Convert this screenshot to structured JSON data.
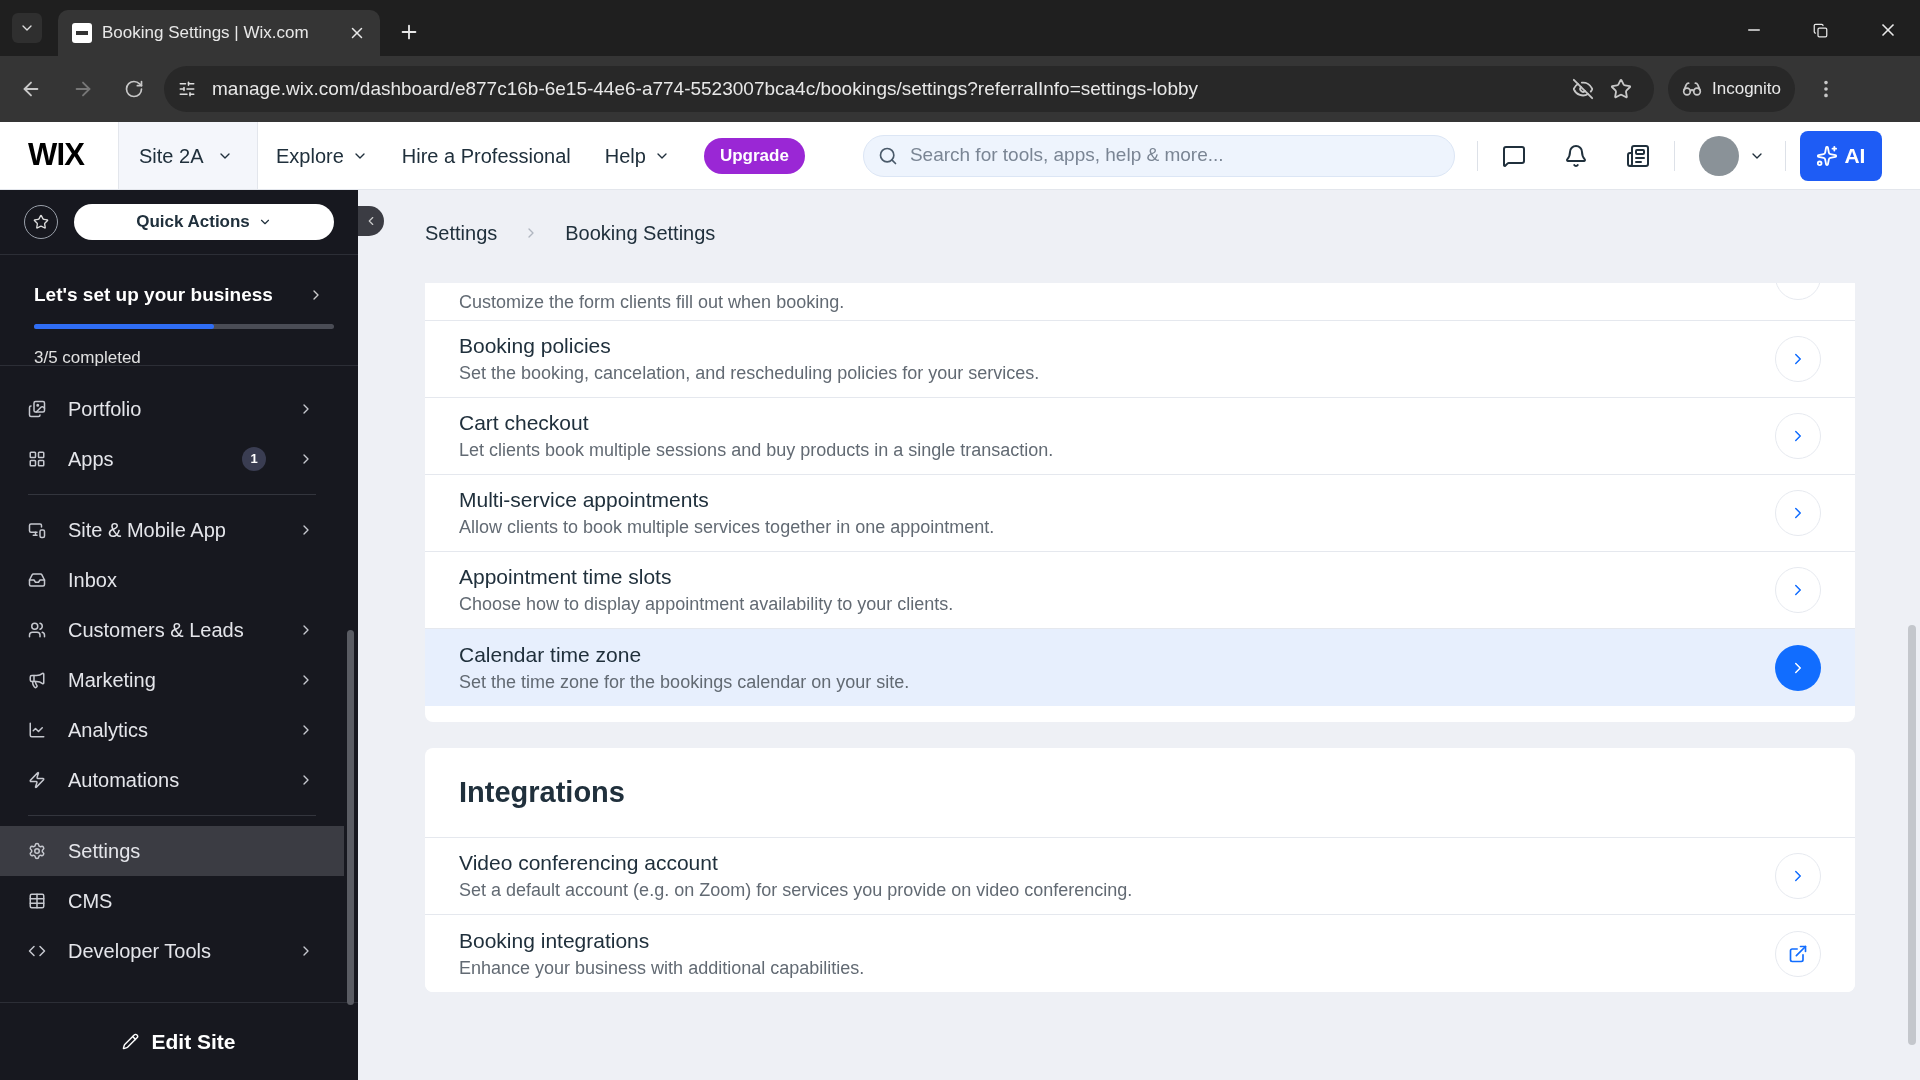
{
  "browser": {
    "tab_title": "Booking Settings | Wix.com",
    "url": "manage.wix.com/dashboard/e877c16b-6e15-44e6-a774-5523007bca4c/bookings/settings?referralInfo=settings-lobby",
    "incognito_label": "Incognito"
  },
  "topbar": {
    "logo": "WIX",
    "site": "Site 2A",
    "nav": [
      {
        "label": "Explore",
        "dropdown": true
      },
      {
        "label": "Hire a Professional",
        "dropdown": false
      },
      {
        "label": "Help",
        "dropdown": true
      }
    ],
    "upgrade": "Upgrade",
    "search_placeholder": "Search for tools, apps, help & more...",
    "ai_label": "AI"
  },
  "sidebar": {
    "quick_actions": "Quick Actions",
    "setup_title": "Let's set up your business",
    "setup": {
      "level": 0.6
    },
    "setup_status": "3/5 completed",
    "items": [
      {
        "label": "Portfolio",
        "arrow": true,
        "selected": false,
        "group_end": false
      },
      {
        "label": "Apps",
        "arrow": true,
        "badge": "1",
        "selected": false,
        "group_end": true
      },
      {
        "label": "Site & Mobile App",
        "arrow": true,
        "selected": false,
        "group_end": false
      },
      {
        "label": "Inbox",
        "arrow": false,
        "selected": false,
        "group_end": false
      },
      {
        "label": "Customers & Leads",
        "arrow": true,
        "selected": false,
        "group_end": false
      },
      {
        "label": "Marketing",
        "arrow": true,
        "selected": false,
        "group_end": false
      },
      {
        "label": "Analytics",
        "arrow": true,
        "selected": false,
        "group_end": false
      },
      {
        "label": "Automations",
        "arrow": true,
        "selected": false,
        "group_end": true
      },
      {
        "label": "Settings",
        "arrow": false,
        "selected": true,
        "group_end": false
      },
      {
        "label": "CMS",
        "arrow": false,
        "selected": false,
        "group_end": false
      },
      {
        "label": "Developer Tools",
        "arrow": true,
        "selected": false,
        "group_end": false
      }
    ],
    "edit_site": "Edit Site"
  },
  "breadcrumb": [
    "Settings",
    "Booking Settings"
  ],
  "sections": [
    {
      "rows": [
        {
          "description": "Customize the form clients fill out when booking.",
          "kind": "chevron",
          "selected": false
        },
        {
          "title": "Booking policies",
          "description": "Set the booking, cancelation, and rescheduling policies for your services.",
          "kind": "chevron",
          "selected": false
        },
        {
          "title": "Cart checkout",
          "description": "Let clients book multiple sessions and buy products in a single transaction.",
          "kind": "chevron",
          "selected": false
        },
        {
          "title": "Multi-service appointments",
          "description": "Allow clients to book multiple services together in one appointment.",
          "kind": "chevron",
          "selected": false
        },
        {
          "title": "Appointment time slots",
          "description": "Choose how to display appointment availability to your clients.",
          "kind": "chevron",
          "selected": false
        },
        {
          "title": "Calendar time zone",
          "description": "Set the time zone for the bookings calendar on your site.",
          "kind": "chevron",
          "selected": true
        }
      ]
    },
    {
      "title": "Integrations",
      "rows": [
        {
          "title": "Video conferencing account",
          "description": "Set a default account (e.g. on Zoom) for services you provide on video conferencing.",
          "kind": "chevron",
          "selected": false
        },
        {
          "title": "Booking integrations",
          "description": "Enhance your business with additional capabilities.",
          "kind": "external",
          "selected": false
        }
      ]
    }
  ]
}
